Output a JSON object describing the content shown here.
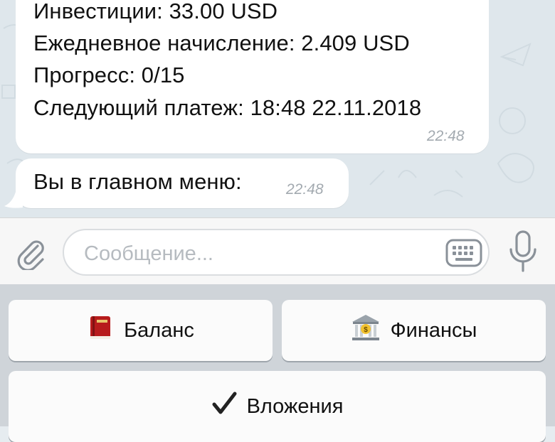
{
  "messages": {
    "card": {
      "lines": [
        "Инвестиции: 33.00 USD",
        "Ежедневное начисление: 2.409 USD",
        "Прогресс: 0/15",
        "Следующий платеж: 18:48 22.11.2018"
      ],
      "time": "22:48"
    },
    "menu": {
      "text": "Вы в главном меню:",
      "time": "22:48"
    }
  },
  "input": {
    "placeholder": "Сообщение..."
  },
  "icons": {
    "attach": "paperclip-icon",
    "keyboard": "keyboard-icon",
    "mic": "microphone-icon"
  },
  "keyboard": {
    "balance": {
      "icon": "ledger-book-icon",
      "label": "Баланс"
    },
    "finance": {
      "icon": "bank-icon",
      "label": "Финансы"
    },
    "invest": {
      "icon": "checkmark-icon",
      "label": "Вложения"
    }
  },
  "colors": {
    "chat_bg": "#dfe7ec",
    "bubble": "#ffffff",
    "time": "#a3aab0",
    "button": "#fbfbfb"
  }
}
